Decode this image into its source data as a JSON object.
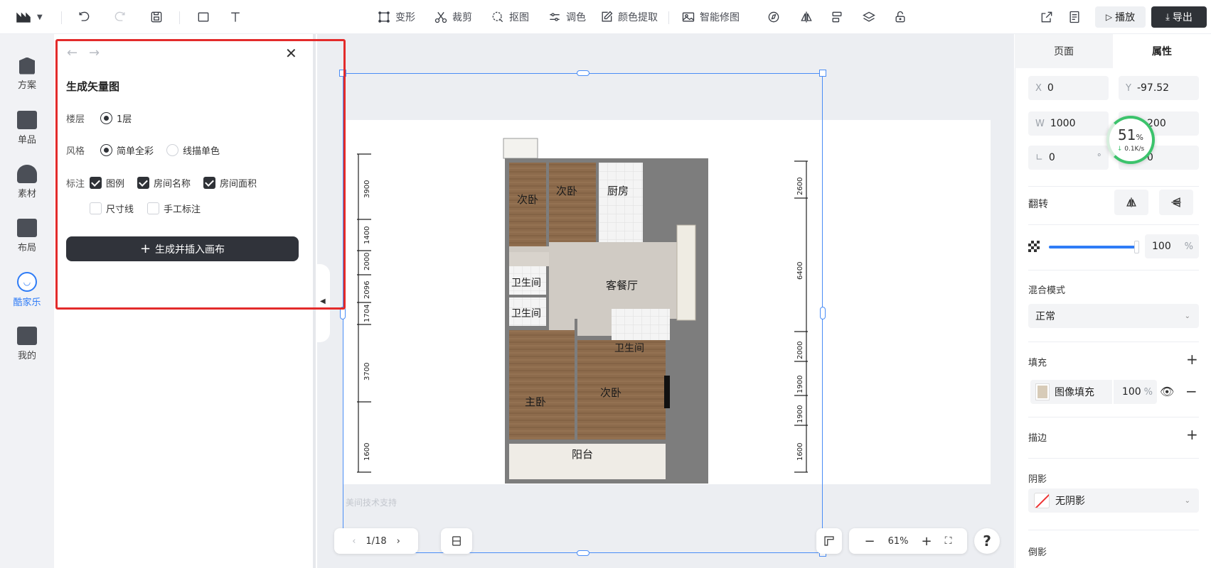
{
  "toolbar": {
    "transform": "变形",
    "crop": "裁剪",
    "cutout": "抠图",
    "adjust": "调色",
    "color_extract": "颜色提取",
    "smart_retouch": "智能修图",
    "play": "播放",
    "export": "导出"
  },
  "leftnav": {
    "items": [
      {
        "label": "方案",
        "icon": "scheme-icon"
      },
      {
        "label": "单品",
        "icon": "product-icon"
      },
      {
        "label": "素材",
        "icon": "material-icon"
      },
      {
        "label": "布局",
        "icon": "layout-icon"
      },
      {
        "label": "酷家乐",
        "icon": "kujiale-icon"
      },
      {
        "label": "我的",
        "icon": "mine-icon"
      }
    ]
  },
  "panel": {
    "title": "生成矢量图",
    "floor_label": "楼层",
    "floor_value": "1层",
    "style_label": "风格",
    "style_option_1": "简单全彩",
    "style_option_2": "线描单色",
    "annotate_label": "标注",
    "annot_legend": "图例",
    "annot_room_name": "房间名称",
    "annot_room_area": "房间面积",
    "annot_dimension": "尺寸线",
    "annot_manual": "手工标注",
    "generate_button": "生成并插入画布"
  },
  "floorplan": {
    "rooms": {
      "bedroom2a": "次卧",
      "bedroom2b": "次卧",
      "kitchen": "厨房",
      "bath1": "卫生间",
      "bath2": "卫生间",
      "bath3": "卫生间",
      "living": "客餐厅",
      "master": "主卧",
      "bedroom2c": "次卧",
      "balcony": "阳台"
    },
    "left_dims": [
      "3900",
      "1400",
      "2000",
      "2096",
      "1704",
      "3700",
      "1600"
    ],
    "right_dims": [
      "2600",
      "6400",
      "2000",
      "1900",
      "1900",
      "1600"
    ],
    "watermark": "美间技术支持"
  },
  "canvas": {
    "page_indicator": "1/18",
    "zoom": "61%",
    "help": "?"
  },
  "network": {
    "percent": "51",
    "percent_sign": "%",
    "speed": "0.1K/s"
  },
  "right": {
    "tab_page": "页面",
    "tab_props": "属性",
    "x_label": "X",
    "x_value": "0",
    "y_label": "Y",
    "y_value": "-97.52",
    "w_label": "W",
    "w_value": "1000",
    "h_value": "200",
    "angle_value": "0",
    "angle_unit": "°",
    "corner_value": "0",
    "flip_label": "翻转",
    "opacity_value": "100",
    "opacity_unit": "%",
    "blend_label": "混合模式",
    "blend_value": "正常",
    "fill_label": "填充",
    "fill_type": "图像填充",
    "fill_opacity": "100",
    "fill_unit": "%",
    "stroke_label": "描边",
    "shadow_label": "阴影",
    "shadow_value": "无阴影",
    "reflection_label": "倒影"
  }
}
